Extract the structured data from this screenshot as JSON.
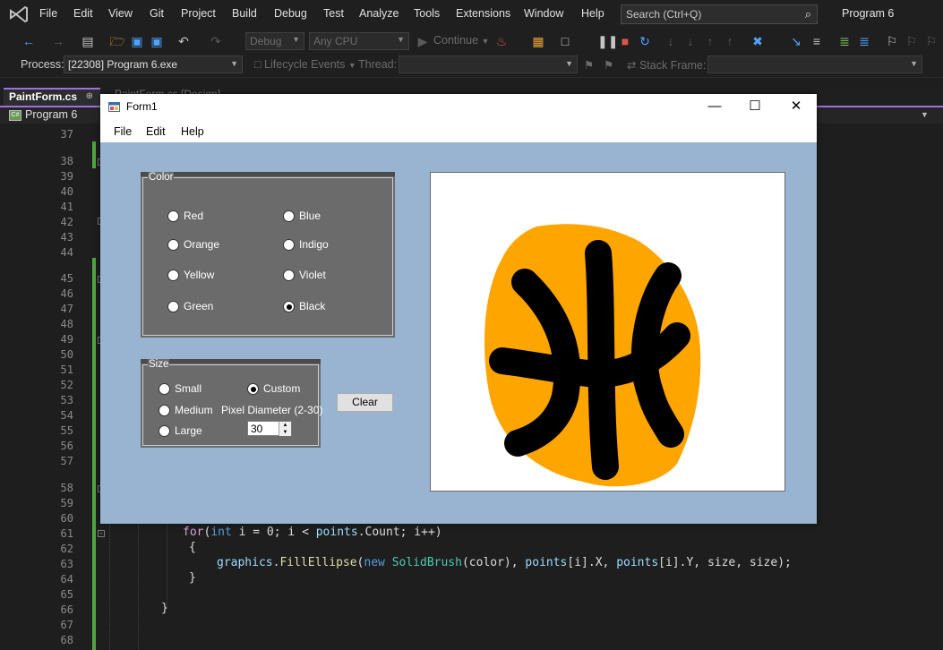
{
  "vs": {
    "menu": [
      "File",
      "Edit",
      "View",
      "Git",
      "Project",
      "Build",
      "Debug",
      "Test",
      "Analyze",
      "Tools",
      "Extensions",
      "Window",
      "Help"
    ],
    "search_placeholder": "Search (Ctrl+Q)",
    "solution_title": "Program 6",
    "config_combo": "Debug",
    "platform_combo": "Any CPU",
    "continue_label": "Continue",
    "process_label": "Process:",
    "process_value": "[22308] Program 6.exe",
    "lifecycle_label": "Lifecycle Events",
    "thread_label": "Thread:",
    "stackframe_label": "Stack Frame:",
    "tab_active": "PaintForm.cs",
    "tab_inactive": "PaintForm.cs [Design]",
    "nav_project": "Program 6",
    "line_numbers": [
      "37",
      "38",
      "39",
      "40",
      "41",
      "42",
      "43",
      "44",
      "45",
      "46",
      "47",
      "48",
      "49",
      "50",
      "51",
      "52",
      "53",
      "54",
      "55",
      "56",
      "57",
      "58",
      "59",
      "60",
      "61",
      "62",
      "63",
      "64",
      "65",
      "66",
      "67",
      "68"
    ]
  },
  "code": {
    "line61": {
      "kw_for": "for",
      "p1": "(",
      "kw_int": "int",
      "p2": " i = 0; i < ",
      "points": "points",
      ".Count; i++)": ".Count; i++)"
    },
    "line62": "{",
    "line63": {
      "graphics": "graphics",
      ".": ".",
      "fill": "FillEllipse",
      "(": "(",
      "new": "new",
      "brush": "SolidBrush",
      "rest1": "(color), ",
      "pts1": "points",
      "idx1": "[i].X, ",
      "pts2": "points",
      "idx2": "[i].Y, size, size);"
    },
    "line64": "}",
    "line66": "}"
  },
  "form": {
    "title": "Form1",
    "menu": [
      "File",
      "Edit",
      "Help"
    ],
    "color_group_title": "Color",
    "colors": [
      {
        "label": "Red",
        "checked": false
      },
      {
        "label": "Orange",
        "checked": false
      },
      {
        "label": "Yellow",
        "checked": false
      },
      {
        "label": "Green",
        "checked": false
      },
      {
        "label": "Blue",
        "checked": false
      },
      {
        "label": "Indigo",
        "checked": false
      },
      {
        "label": "Violet",
        "checked": false
      },
      {
        "label": "Black",
        "checked": true
      }
    ],
    "size_group_title": "Size",
    "sizes": [
      {
        "label": "Small",
        "checked": false
      },
      {
        "label": "Medium",
        "checked": false
      },
      {
        "label": "Large",
        "checked": false
      },
      {
        "label": "Custom",
        "checked": true
      }
    ],
    "pixel_label": "Pixel Diameter (2-30)",
    "pixel_value": "30",
    "clear_label": "Clear"
  },
  "colors": {
    "form_bg": "#99b4d1",
    "group_bg": "#6b6b6b",
    "paint_orange": "#FFA500",
    "paint_black": "#000000"
  }
}
